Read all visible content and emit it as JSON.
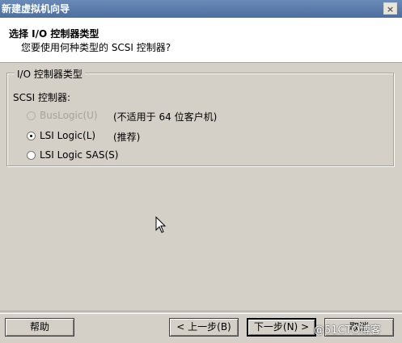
{
  "window": {
    "title": "新建虚拟机向导",
    "close_label": "×"
  },
  "header": {
    "title": "选择 I/O 控制器类型",
    "subtitle": "您要使用何种类型的 SCSI 控制器?"
  },
  "group": {
    "legend": "I/O 控制器类型",
    "scsi_label": "SCSI 控制器:",
    "options": [
      {
        "label": "BusLogic(U)",
        "note": "(不适用于 64 位客户机)",
        "checked": false,
        "disabled": true
      },
      {
        "label": "LSI Logic(L)",
        "note": "(推荐)",
        "checked": true,
        "disabled": false
      },
      {
        "label": "LSI Logic SAS(S)",
        "note": "",
        "checked": false,
        "disabled": false
      }
    ]
  },
  "footer": {
    "help": "帮助",
    "back": "< 上一步(B)",
    "next": "下一步(N) >",
    "cancel": "取消"
  },
  "watermark": "@51CTO博客"
}
